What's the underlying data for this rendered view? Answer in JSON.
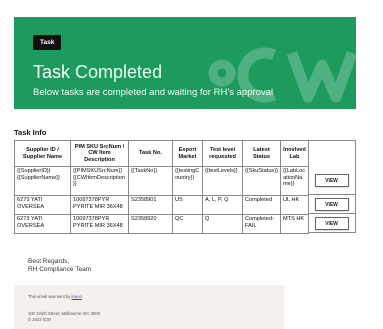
{
  "banner": {
    "badge": "Task",
    "title_strong": "Task",
    "title_light": "Completed",
    "subtitle": "Below tasks are completed and waiting for RH’s approval",
    "brand_color": "#1d9b5d"
  },
  "section": {
    "title": "Task Info"
  },
  "table": {
    "headers": [
      "Supplier ID / Supplier Name",
      "PIM SKU SrcNum / CW Item Description",
      "Task No.",
      "Export Market",
      "Test level requested",
      "Latest Status",
      "Inovlved Lab"
    ],
    "rows": [
      [
        "{{SupplierID}} {{SupplierName}}",
        "{{PIMSKUSrcNum}} {{CWItemDescription}}",
        "{{TaskNo}}",
        "{{testingCountry}}",
        "{{testLevels}}",
        "{{SkuStatus}}",
        "{{LabLocationName}}"
      ],
      [
        "6273 YATI OVERSEA",
        "10097378PYR PYRITE MIR 36X48",
        "S2358901",
        "US",
        "A, L, P, Q",
        "Completed",
        "UL HK"
      ],
      [
        "6273 YATI OVERSEA",
        "10097378PYR PYRITE MIR 36X48",
        "S2358920",
        "QC",
        "Q",
        "Completed-FAIL",
        "MTS HK"
      ]
    ],
    "view_label": "VIEW"
  },
  "signoff": {
    "line1": "Best Regards,",
    "line2": "RH Compliance Team"
  },
  "footer": {
    "sent_by_prefix": "This email was sent by",
    "sent_by_link": "icw.io",
    "address_line1": "100 Smith Street, Melbourne VIC 3000",
    "address_line2": "© 2022 ICW"
  }
}
